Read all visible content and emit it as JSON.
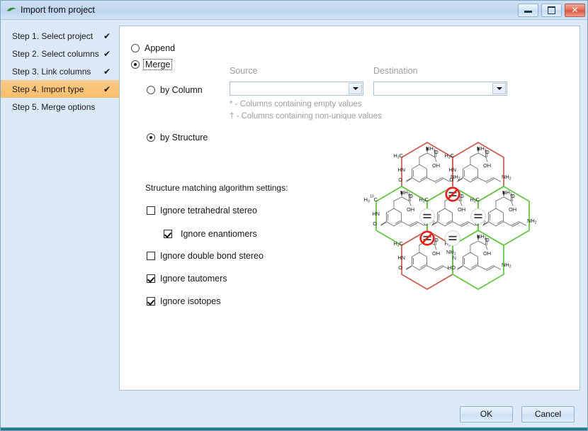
{
  "window": {
    "title": "Import from project",
    "icon": "leaf-icon",
    "buttons": {
      "minimize": "minimize-icon",
      "maximize": "maximize-icon",
      "close": "✕"
    }
  },
  "sidebar": {
    "items": [
      {
        "label": "Step 1. Select project",
        "check": "✔",
        "active": false
      },
      {
        "label": "Step 2. Select columns",
        "check": "✔",
        "active": false
      },
      {
        "label": "Step 3. Link columns",
        "check": "✔",
        "active": false
      },
      {
        "label": "Step 4. Import type",
        "check": "✔",
        "active": true
      },
      {
        "label": "Step 5. Merge options",
        "check": "",
        "active": false
      }
    ]
  },
  "main": {
    "import_mode": {
      "append": {
        "label": "Append",
        "selected": false
      },
      "merge": {
        "label": "Merge",
        "selected": true,
        "focused": true
      }
    },
    "by_column": {
      "label": "by Column",
      "selected": false
    },
    "by_structure": {
      "label": "by Structure",
      "selected": true
    },
    "source": {
      "label": "Source",
      "value": "",
      "placeholder": ""
    },
    "destination": {
      "label": "Destination",
      "value": "",
      "placeholder": ""
    },
    "hints": [
      "* - Columns containing empty values",
      "† - Columns containing non-unique values"
    ],
    "settings_title": "Structure matching algorithm settings:",
    "settings": [
      {
        "label": "Ignore tetrahedral stereo",
        "checked": false,
        "indent": 0
      },
      {
        "label": "Ignore enantiomers",
        "checked": true,
        "indent": 1
      },
      {
        "label": "Ignore double bond stereo",
        "checked": false,
        "indent": 0
      },
      {
        "label": "Ignore tautomers",
        "checked": true,
        "indent": 0
      },
      {
        "label": "Ignore isotopes",
        "checked": true,
        "indent": 0
      }
    ]
  },
  "illustration": {
    "name": "structure-match-honeycomb",
    "colors": {
      "match_edge": "#5ec840",
      "mismatch_edge": "#cc5b4e",
      "badge_equal": "#9b9b9b",
      "badge_not_equal": "#e2231a"
    },
    "cells": [
      {
        "id": "cell-top-left",
        "edge": "mismatch",
        "molecule": "alanine-pyridinone-allylamine",
        "labels": [
          "NH2",
          "H3C",
          "O",
          "OH",
          "HN",
          "O",
          "NH2"
        ],
        "stereo": "wedge"
      },
      {
        "id": "cell-top-right",
        "edge": "mismatch",
        "molecule": "alanine-pyridinone-allylamine",
        "labels": [
          "NH2",
          "H3C",
          "O",
          "OH",
          "HN",
          "O",
          "NH2"
        ],
        "stereo": "none"
      },
      {
        "id": "cell-mid-left",
        "edge": "match",
        "molecule": "alanine-pyridinone-allylamine",
        "labels": [
          "NH2",
          "H3 13C",
          "O",
          "OH",
          "HN",
          "O",
          "NH2"
        ],
        "stereo": "wedge-isotope"
      },
      {
        "id": "cell-mid-center",
        "edge": "match",
        "molecule": "alanine-pyridinone-allylamine",
        "labels": [
          "NH2",
          "H3C",
          "O",
          "OH",
          "HN",
          "O",
          "NH2"
        ],
        "stereo": "wedge"
      },
      {
        "id": "cell-mid-right",
        "edge": "match",
        "molecule": "alanine-pyridinone-allylamine",
        "labels": [
          "NH2",
          "H3C",
          "O",
          "OH",
          "HN",
          "O",
          "NH2"
        ],
        "stereo": "wedge"
      },
      {
        "id": "cell-bottom-left",
        "edge": "mismatch",
        "molecule": "alanine-pyridinone-cis-allylamine",
        "labels": [
          "NH2",
          "H3C",
          "O",
          "OH",
          "HN",
          "O",
          "NH2"
        ],
        "stereo": "wedge-cis"
      },
      {
        "id": "cell-bottom-right",
        "edge": "match",
        "molecule": "alanine-hydroxypyridine-allylamine",
        "labels": [
          "NH2",
          "H3C",
          "O",
          "OH",
          "N",
          "HO",
          "NH2"
        ],
        "stereo": "wedge-tautomer"
      }
    ],
    "badges": [
      {
        "id": "badge-not-equal-top",
        "type": "not-equal",
        "symbol": "="
      },
      {
        "id": "badge-equal-left",
        "type": "equal",
        "symbol": "="
      },
      {
        "id": "badge-equal-right",
        "type": "equal",
        "symbol": "="
      },
      {
        "id": "badge-not-equal-bottom",
        "type": "not-equal",
        "symbol": "="
      },
      {
        "id": "badge-equal-bottom",
        "type": "equal",
        "symbol": "="
      }
    ]
  },
  "footer": {
    "ok_label": "OK",
    "cancel_label": "Cancel"
  }
}
